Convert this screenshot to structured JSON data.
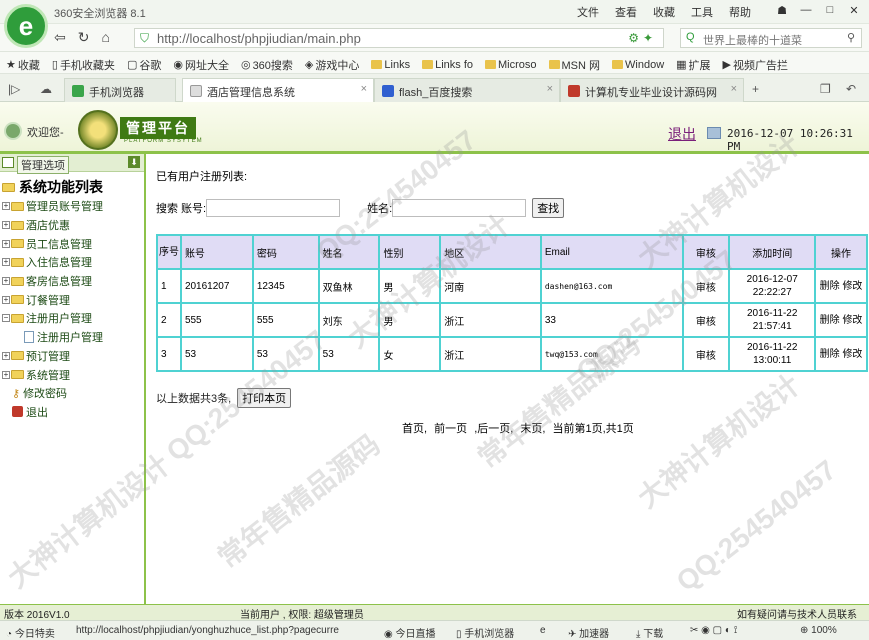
{
  "browser": {
    "title": "360安全浏览器 8.1",
    "menu": [
      "文件",
      "查看",
      "收藏",
      "工具",
      "帮助"
    ],
    "url": "http://localhost/phpjiudian/main.php",
    "search_placeholder": "世界上最棒的十道菜",
    "favorites": [
      "收藏",
      "手机收藏夹",
      "谷歌",
      "网址大全",
      "360搜索",
      "游戏中心",
      "Links",
      "Links fo",
      "Microso",
      "MSN 网",
      "Window",
      "扩展",
      "视频广告拦"
    ],
    "tabs": [
      "手机浏览器",
      "酒店管理信息系统",
      "flash_百度搜索",
      "计算机专业毕业设计源码网"
    ]
  },
  "header": {
    "welcome": "欢迎您-",
    "platform_title": "管理平台",
    "platform_sub": "PLATFORM SYSYTEM",
    "logout": "退出",
    "datetime": "2016-12-07 10:26:31 PM"
  },
  "sidebar": {
    "head_label": "管理选项",
    "root_label": "系统功能列表",
    "items": [
      "管理员账号管理",
      "酒店优惠",
      "员工信息管理",
      "入住信息管理",
      "客房信息管理",
      "订餐管理",
      "注册用户管理",
      "注册用户管理",
      "预订管理",
      "系统管理",
      "修改密码",
      "退出"
    ]
  },
  "main": {
    "list_title": "已有用户注册列表:",
    "search_label": "搜索 账号:",
    "name_label": "姓名:",
    "search_button": "查找",
    "columns": [
      "序号",
      "账号",
      "密码",
      "姓名",
      "性别",
      "地区",
      "Email",
      "审核",
      "添加时间",
      "操作"
    ],
    "rows": [
      {
        "no": "1",
        "account": "20161207",
        "password": "12345",
        "name": "双鱼林",
        "gender": "男",
        "region": "河南",
        "email": "dashen@163.com",
        "audit": "审核",
        "time1": "2016-12-07",
        "time2": "22:22:27",
        "op1": "删除",
        "op2": "修改"
      },
      {
        "no": "2",
        "account": "555",
        "password": "555",
        "name": "刘东",
        "gender": "男",
        "region": "浙江",
        "email": "33",
        "audit": "审核",
        "time1": "2016-11-22",
        "time2": "21:57:41",
        "op1": "删除",
        "op2": "修改"
      },
      {
        "no": "3",
        "account": "53",
        "password": "53",
        "name": "53",
        "gender": "女",
        "region": "浙江",
        "email": "twq@153.com",
        "audit": "审核",
        "time1": "2016-11-22",
        "time2": "13:00:11",
        "op1": "删除",
        "op2": "修改"
      }
    ],
    "summary": "以上数据共3条,",
    "print_button": "打印本页",
    "pager": [
      "首页,",
      "前一页",
      ",后一页,",
      "末页,",
      "当前第1页,共1页"
    ]
  },
  "footer": {
    "version": "版本 2016V1.0",
    "user_info": "当前用户 , 权限: 超级管理员",
    "help": "如有疑问请与技术人员联系"
  },
  "statusbar": {
    "today": "今日特卖",
    "url": "http://localhost/phpjiudian/yonghuzhuce_list.php?pagecurre",
    "live": "今日直播",
    "mobile": "手机浏览器",
    "accelerator": "加速器",
    "download": "下载",
    "zoom": "100%"
  },
  "watermark": {
    "qq": "QQ:254540457",
    "text1": "大神计算机设计",
    "text2": "常年售精品源码"
  }
}
